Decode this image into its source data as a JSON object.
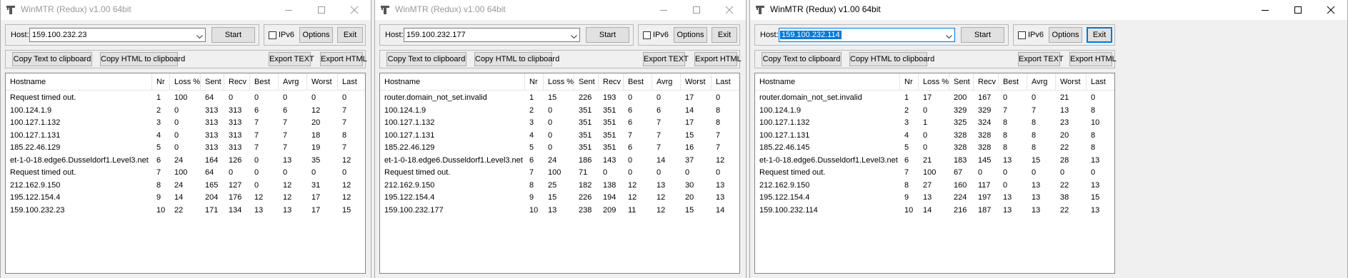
{
  "columns": [
    "Hostname",
    "Nr",
    "Loss %",
    "Sent",
    "Recv",
    "Best",
    "Avrg",
    "Worst",
    "Last"
  ],
  "labels": {
    "host": "Host:",
    "start": "Start",
    "ipv6": "IPv6",
    "options": "Options",
    "exit": "Exit",
    "copy_text": "Copy Text to clipboard",
    "copy_html": "Copy HTML to clipboard",
    "export_text": "Export TEXT",
    "export_html": "Export HTML"
  },
  "windows": [
    {
      "title": "WinMTR (Redux) v1.00 64bit",
      "active": false,
      "host_value": "159.100.232.23",
      "rows": [
        [
          "Request timed out.",
          "1",
          "100",
          "64",
          "0",
          "0",
          "0",
          "0",
          "0"
        ],
        [
          "100.124.1.9",
          "2",
          "0",
          "313",
          "313",
          "6",
          "6",
          "12",
          "7"
        ],
        [
          "100.127.1.132",
          "3",
          "0",
          "313",
          "313",
          "7",
          "7",
          "20",
          "7"
        ],
        [
          "100.127.1.131",
          "4",
          "0",
          "313",
          "313",
          "7",
          "7",
          "18",
          "8"
        ],
        [
          "185.22.46.129",
          "5",
          "0",
          "313",
          "313",
          "7",
          "7",
          "19",
          "7"
        ],
        [
          "et-1-0-18.edge6.Dusseldorf1.Level3.net",
          "6",
          "24",
          "164",
          "126",
          "0",
          "13",
          "35",
          "12"
        ],
        [
          "Request timed out.",
          "7",
          "100",
          "64",
          "0",
          "0",
          "0",
          "0",
          "0"
        ],
        [
          "212.162.9.150",
          "8",
          "24",
          "165",
          "127",
          "0",
          "12",
          "31",
          "12"
        ],
        [
          "195.122.154.4",
          "9",
          "14",
          "204",
          "176",
          "12",
          "12",
          "17",
          "12"
        ],
        [
          "159.100.232.23",
          "10",
          "22",
          "171",
          "134",
          "13",
          "13",
          "17",
          "15"
        ]
      ]
    },
    {
      "title": "WinMTR (Redux) v1.00 64bit",
      "active": false,
      "host_value": "159.100.232.177",
      "rows": [
        [
          "router.domain_not_set.invalid",
          "1",
          "15",
          "226",
          "193",
          "0",
          "0",
          "17",
          "0"
        ],
        [
          "100.124.1.9",
          "2",
          "0",
          "351",
          "351",
          "6",
          "6",
          "14",
          "8"
        ],
        [
          "100.127.1.132",
          "3",
          "0",
          "351",
          "351",
          "6",
          "7",
          "17",
          "8"
        ],
        [
          "100.127.1.131",
          "4",
          "0",
          "351",
          "351",
          "7",
          "7",
          "15",
          "7"
        ],
        [
          "185.22.46.129",
          "5",
          "0",
          "351",
          "351",
          "6",
          "7",
          "16",
          "7"
        ],
        [
          "et-1-0-18.edge6.Dusseldorf1.Level3.net",
          "6",
          "24",
          "186",
          "143",
          "0",
          "14",
          "37",
          "12"
        ],
        [
          "Request timed out.",
          "7",
          "100",
          "71",
          "0",
          "0",
          "0",
          "0",
          "0"
        ],
        [
          "212.162.9.150",
          "8",
          "25",
          "182",
          "138",
          "12",
          "13",
          "30",
          "13"
        ],
        [
          "195.122.154.4",
          "9",
          "15",
          "226",
          "194",
          "12",
          "12",
          "20",
          "13"
        ],
        [
          "159.100.232.177",
          "10",
          "13",
          "238",
          "209",
          "11",
          "12",
          "15",
          "14"
        ]
      ]
    },
    {
      "title": "WinMTR (Redux) v1.00 64bit",
      "active": true,
      "host_value": "159.100.232.114",
      "rows": [
        [
          "router.domain_not_set.invalid",
          "1",
          "17",
          "200",
          "167",
          "0",
          "0",
          "21",
          "0"
        ],
        [
          "100.124.1.9",
          "2",
          "0",
          "329",
          "329",
          "7",
          "7",
          "13",
          "8"
        ],
        [
          "100.127.1.132",
          "3",
          "1",
          "325",
          "324",
          "8",
          "8",
          "23",
          "10"
        ],
        [
          "100.127.1.131",
          "4",
          "0",
          "328",
          "328",
          "8",
          "8",
          "20",
          "8"
        ],
        [
          "185.22.46.145",
          "5",
          "0",
          "328",
          "328",
          "8",
          "8",
          "22",
          "8"
        ],
        [
          "et-1-0-18.edge6.Dusseldorf1.Level3.net",
          "6",
          "21",
          "183",
          "145",
          "13",
          "15",
          "28",
          "13"
        ],
        [
          "Request timed out.",
          "7",
          "100",
          "67",
          "0",
          "0",
          "0",
          "0",
          "0"
        ],
        [
          "212.162.9.150",
          "8",
          "27",
          "160",
          "117",
          "0",
          "13",
          "22",
          "13"
        ],
        [
          "195.122.154.4",
          "9",
          "13",
          "224",
          "197",
          "13",
          "13",
          "38",
          "15"
        ],
        [
          "159.100.232.114",
          "10",
          "14",
          "216",
          "187",
          "13",
          "13",
          "22",
          "13"
        ]
      ]
    }
  ]
}
